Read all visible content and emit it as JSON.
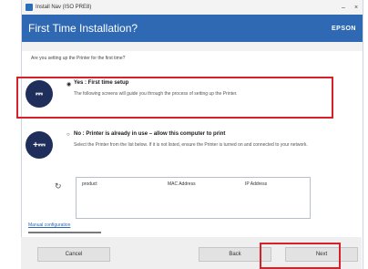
{
  "window": {
    "title": "Install Nav (ISO PRE8)",
    "controls": [
      "–",
      "×"
    ]
  },
  "header": {
    "title": "First Time Installation?",
    "brand": "EPSON"
  },
  "question": "Are you setting up the Printer for the first time?",
  "options": [
    {
      "selected": true,
      "radio": "◉",
      "label": "Yes : First time setup",
      "description": "The following screens will guide you through the process of setting up the Printer."
    },
    {
      "selected": false,
      "radio": "○",
      "label": "No : Printer is already in use – allow this computer to print",
      "description": "Select the Printer from the list below. If it is not listed, ensure the Printer is turned on and connected to your network."
    }
  ],
  "printer_table": {
    "refresh_icon": "refresh-icon",
    "refresh_glyph": "↻",
    "columns": [
      "product",
      "MAC Address",
      "IP Address"
    ]
  },
  "advanced_link": "Manual configuration",
  "buttons": {
    "cancel": "Cancel",
    "back": "Back",
    "next": "Next"
  },
  "colors": {
    "header": "#2f69b3",
    "highlight": "#d6202a",
    "badge": "#1f2e5a"
  }
}
